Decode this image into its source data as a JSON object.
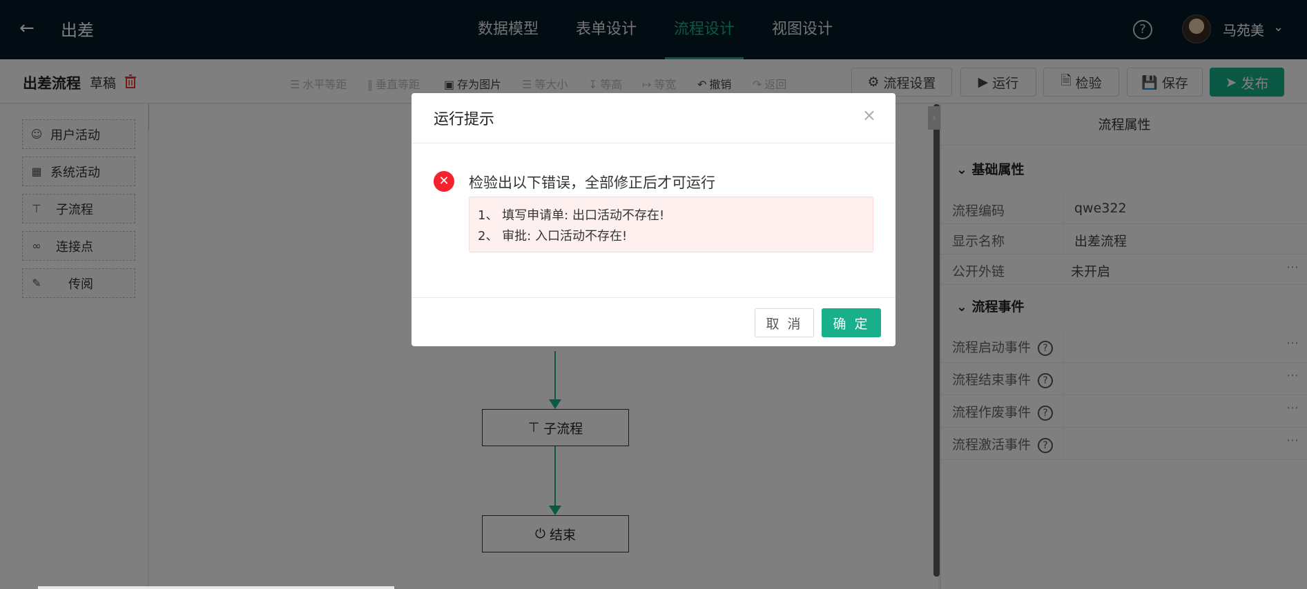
{
  "header": {
    "back_icon": "arrow-left-icon",
    "app_title": "出差",
    "tabs": [
      {
        "label": "数据模型",
        "active": false
      },
      {
        "label": "表单设计",
        "active": false
      },
      {
        "label": "流程设计",
        "active": true
      },
      {
        "label": "视图设计",
        "active": false
      }
    ],
    "help_icon": "question-circle-icon",
    "user_name": "马苑美"
  },
  "toolbar": {
    "flow_name": "出差流程",
    "status": "草稿",
    "tools": [
      {
        "label": "水平等距",
        "enabled": false
      },
      {
        "label": "垂直等距",
        "enabled": false
      },
      {
        "label": "存为图片",
        "enabled": true
      },
      {
        "label": "等大小",
        "enabled": false
      },
      {
        "label": "等高",
        "enabled": false
      },
      {
        "label": "等宽",
        "enabled": false
      },
      {
        "label": "撤销",
        "enabled": true
      },
      {
        "label": "返回",
        "enabled": false
      }
    ],
    "buttons": {
      "settings": "流程设置",
      "run": "运行",
      "check": "检验",
      "save": "保存",
      "publish": "发布"
    }
  },
  "palette": {
    "items": [
      {
        "label": "用户活动",
        "icon": "user-icon"
      },
      {
        "label": "系统活动",
        "icon": "grid-icon"
      },
      {
        "label": "子流程",
        "icon": "subflow-icon"
      },
      {
        "label": "连接点",
        "icon": "link-icon"
      },
      {
        "label": "传阅",
        "icon": "document-icon"
      }
    ]
  },
  "canvas": {
    "nodes": {
      "subflow": "子流程",
      "end": "结束"
    }
  },
  "properties": {
    "title": "流程属性",
    "basic": {
      "title": "基础属性",
      "rows": [
        {
          "label": "流程编码",
          "value": "qwe322"
        },
        {
          "label": "显示名称",
          "value": "出差流程"
        },
        {
          "label": "公开外链",
          "value": "未开启"
        }
      ]
    },
    "events": {
      "title": "流程事件",
      "rows": [
        {
          "label": "流程启动事件"
        },
        {
          "label": "流程结束事件"
        },
        {
          "label": "流程作废事件"
        },
        {
          "label": "流程激活事件"
        }
      ]
    }
  },
  "modal": {
    "title": "运行提示",
    "error_title": "检验出以下错误，全部修正后才可运行",
    "errors": [
      "1、 填写申请单: 出口活动不存在!",
      "2、 审批: 入口活动不存在!"
    ],
    "cancel": "取 消",
    "ok": "确 定"
  },
  "colors": {
    "accent": "#17b08a",
    "header_bg": "#031a24",
    "error": "#f5222d"
  }
}
